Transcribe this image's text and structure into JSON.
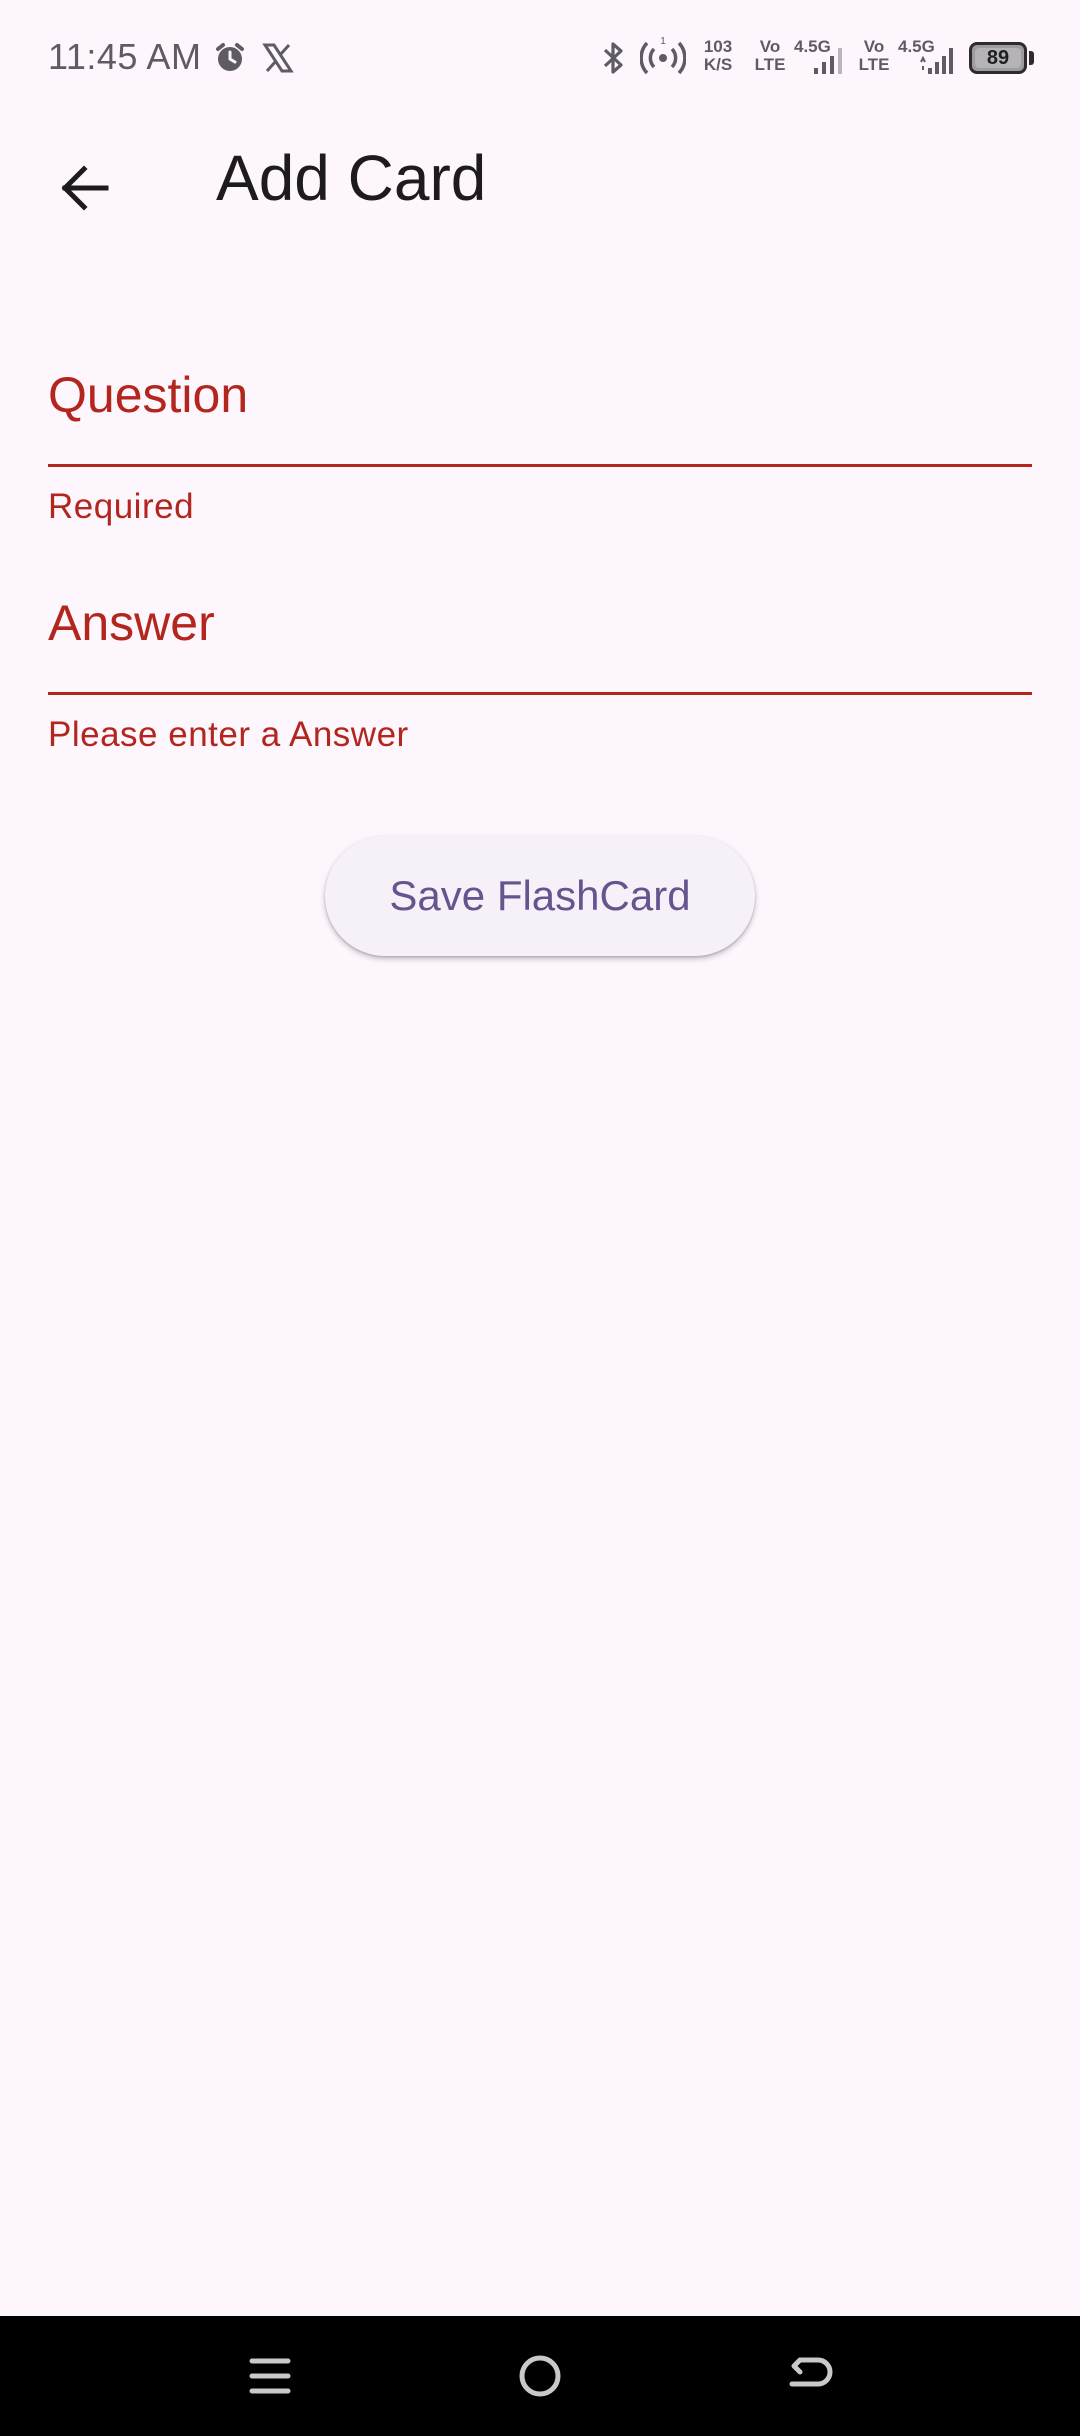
{
  "status_bar": {
    "time": "11:45 AM",
    "net_speed_value": "103",
    "net_speed_unit": "K/S",
    "sim1_vo": "Vo",
    "sim1_lte": "LTE",
    "sim1_net": "4.5G",
    "sim2_vo": "Vo",
    "sim2_lte": "LTE",
    "sim2_net": "4.5G",
    "battery_level": "89",
    "icons": [
      "alarm-icon",
      "x-app-icon",
      "bluetooth-icon",
      "hotspot-icon",
      "signal-icon",
      "battery-icon"
    ]
  },
  "app_bar": {
    "title": "Add Card"
  },
  "form": {
    "question": {
      "placeholder": "Question",
      "error": "Required"
    },
    "answer": {
      "placeholder": "Answer",
      "error": "Please enter a Answer"
    },
    "save_label": "Save FlashCard"
  },
  "colors": {
    "background": "#fdf7fd",
    "error": "#b3261e",
    "button_text": "#65558f",
    "button_bg": "#f6f1f8"
  }
}
